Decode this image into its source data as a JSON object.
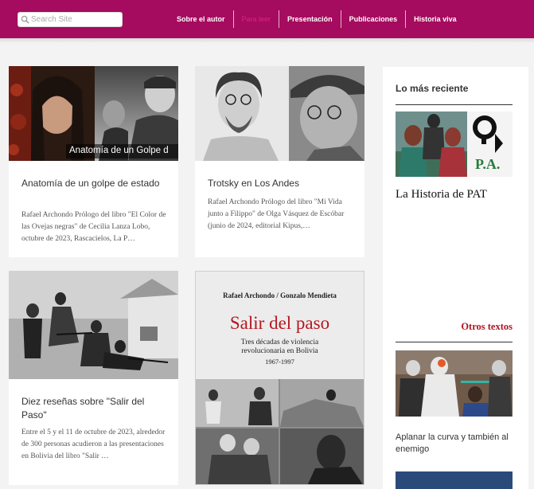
{
  "header": {
    "search_placeholder": "Search Site",
    "nav": [
      {
        "label": "Sobre el autor",
        "active": false
      },
      {
        "label": "Para leer",
        "active": true
      },
      {
        "label": "Presentación",
        "active": false
      },
      {
        "label": "Publicaciones",
        "active": false
      },
      {
        "label": "Historia viva",
        "active": false
      }
    ],
    "brand_color": "#a50b5e"
  },
  "cards": [
    {
      "image_caption": "Anatomía de un Golpe d",
      "title": "Anatomía de un golpe de estado",
      "excerpt": "Rafael Archondo Prólogo del libro \"El Color de las Ovejas negras\" de Cecilia Lanza Lobo, octubre de 2023, Rascacielos, La P…"
    },
    {
      "title": "Trotsky en Los Andes",
      "excerpt": "Rafael Archondo Prólogo del libro \"Mi Vida junto a Filippo\" de Olga Vásquez de Escóbar (junio de 2024, editorial Kipus,…"
    },
    {
      "title": "Diez reseñas sobre \"Salir del Paso\"",
      "excerpt": "Entre el 5 y el 11 de octubre de 2023, alrededor de 300 personas acudieron a las presentaciones en Bolivia del libro \"Salir …"
    },
    {
      "book_authors": "Rafael Archondo / Gonzalo Mendieta",
      "book_title": "Salir del paso",
      "book_subtitle": "Tres décadas de violencia revolucionaria en Bolivia",
      "book_years": "1967-1997"
    }
  ],
  "sidebar": {
    "recent_heading": "Lo más reciente",
    "recent_item_title": "La Historia de PAT",
    "recent_logo_text": "P.A.",
    "others_heading": "Otros textos",
    "others_item_title": "Aplanar la curva y también al enemigo"
  }
}
